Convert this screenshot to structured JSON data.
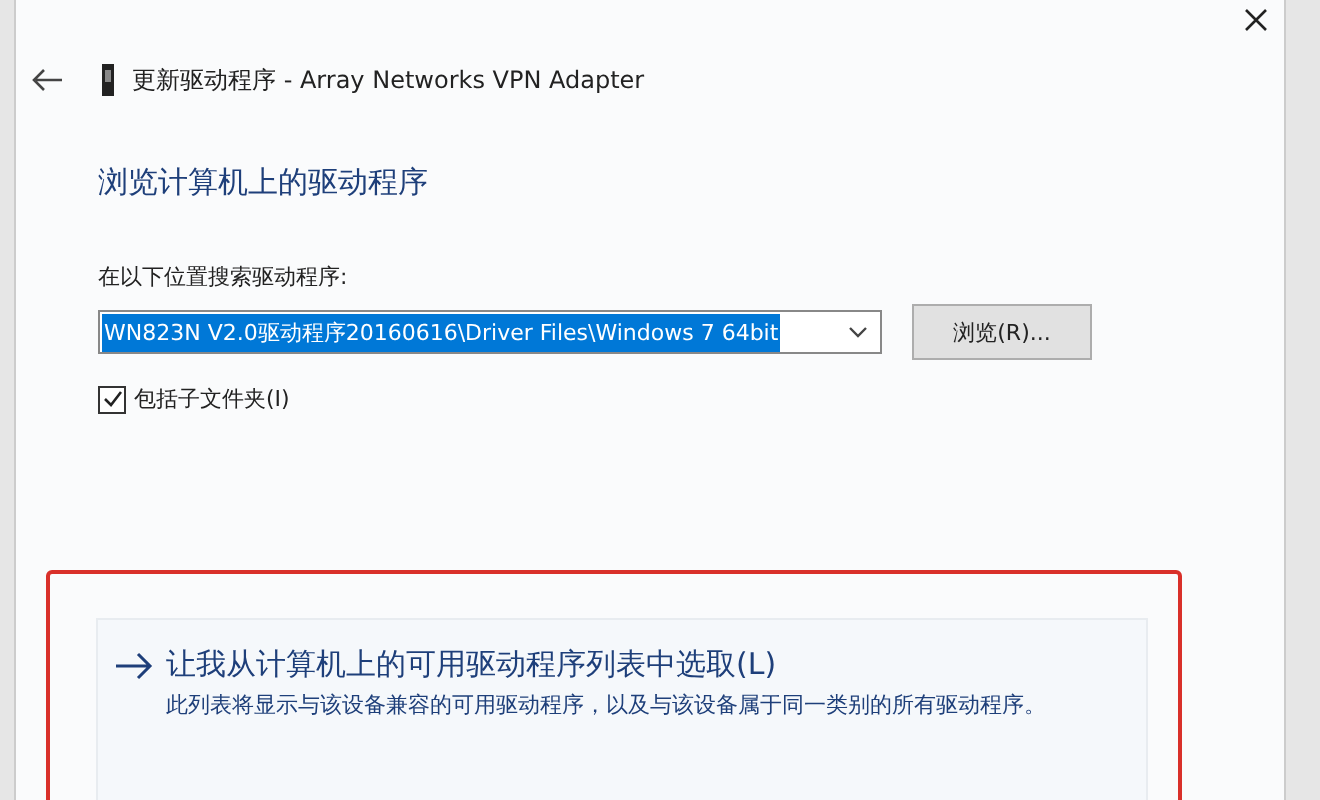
{
  "window": {
    "title": "更新驱动程序 - Array Networks VPN Adapter"
  },
  "heading": "浏览计算机上的驱动程序",
  "search": {
    "label": "在以下位置搜索驱动程序:",
    "value": "WN823N V2.0驱动程序20160616\\Driver Files\\Windows 7 64bit",
    "browse_button": "浏览(R)..."
  },
  "include_subfolders": {
    "label": "包括子文件夹(I)",
    "checked": true
  },
  "option": {
    "highlighted": true,
    "title": "让我从计算机上的可用驱动程序列表中选取(L)",
    "description": "此列表将显示与该设备兼容的可用驱动程序，以及与该设备属于同一类别的所有驱动程序。"
  }
}
